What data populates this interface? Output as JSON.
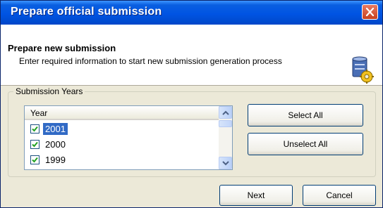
{
  "window": {
    "title": "Prepare official submission"
  },
  "header": {
    "title": "Prepare new submission",
    "description": "Enter required information to start new submission generation process"
  },
  "group": {
    "legend": "Submission Years",
    "list": {
      "column_header": "Year",
      "rows": [
        {
          "label": "2001",
          "checked": true,
          "selected": true
        },
        {
          "label": "2000",
          "checked": true,
          "selected": false
        },
        {
          "label": "1999",
          "checked": true,
          "selected": false
        }
      ]
    },
    "select_all_label": "Select All",
    "unselect_all_label": "Unselect All"
  },
  "footer": {
    "next_label": "Next",
    "cancel_label": "Cancel"
  },
  "colors": {
    "titlebar": "#0054e3",
    "selection": "#316ac5",
    "close": "#c6411f"
  },
  "icons": {
    "close": "close-icon",
    "header": "database-gear-icon",
    "check": "checkmark-icon"
  }
}
